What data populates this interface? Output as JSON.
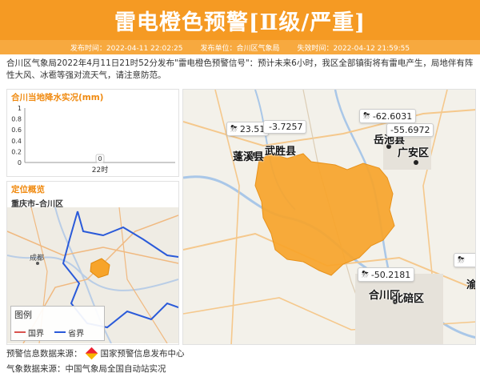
{
  "banner": {
    "title": "雷电橙色预警[Ⅱ级/严重]"
  },
  "meta": {
    "publish_time": "发布时间：2022-04-11 22:02:25",
    "publisher": "发布单位：合川区气象局",
    "expire_time": "失效时间：2022-04-12 21:59:55"
  },
  "description": "合川区气象局2022年4月11日21时52分发布\"雷电橙色预警信号\"：预计未来6小时，我区全部镇街将有雷电产生，局地伴有阵性大风、冰雹等强对流天气，请注意防范。",
  "rain_panel": {
    "title": "合川当地降水实况(mm)",
    "chart_data": {
      "type": "bar",
      "categories": [
        "22时"
      ],
      "values": [
        0
      ],
      "title": "合川当地降水实况(mm)",
      "ylim": [
        0,
        1
      ],
      "yticks": [
        "1",
        "0.8",
        "0.6",
        "0.4",
        "0.2",
        "0"
      ],
      "data_labels": [
        "0"
      ]
    }
  },
  "location_panel": {
    "title": "定位概览",
    "place": "重庆市–合川区",
    "small_labels": {
      "chengdu": "成都"
    },
    "legend": {
      "title": "图例",
      "national": "国界",
      "provincial": "省界"
    },
    "colors": {
      "national": "#d9534f",
      "provincial": "#2a5ad9"
    }
  },
  "map": {
    "highlight_color": "#f7a42a",
    "places": {
      "pengxi": "蓬溪县",
      "wusheng": "武胜县",
      "yuechi": "岳池县",
      "guangan": "广安区",
      "hechuan": "合川区",
      "beibei": "北碚区",
      "yu": "渝"
    },
    "readings": {
      "r1": "23.51",
      "r2": "-3.7257",
      "r3": "-62.6031",
      "r4": "-55.6972",
      "r5": "-50.2181"
    }
  },
  "footer": {
    "source1_label": "预警信息数据来源：",
    "source1_org": "国家预警信息发布中心",
    "source2": "气象数据来源：中国气象局全国自动站实况"
  }
}
